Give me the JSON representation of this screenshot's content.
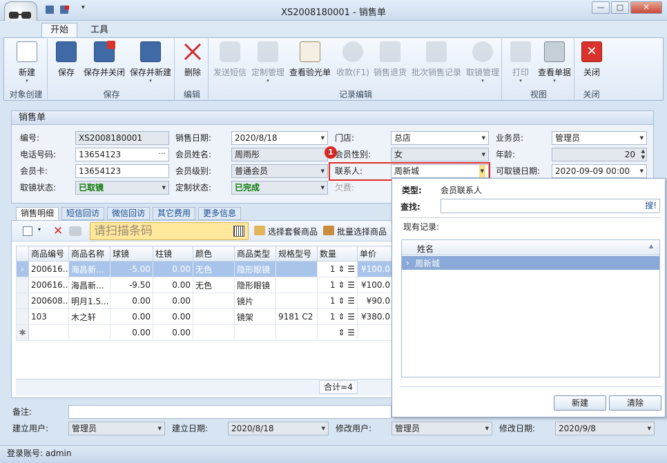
{
  "window": {
    "title": "XS2008180001 - 销售单"
  },
  "ribbon": {
    "tabs": [
      "开始",
      "工具"
    ],
    "groups": [
      "对象创建",
      "保存",
      "编辑",
      "记录编辑",
      "视图",
      "关闭"
    ],
    "buttons": {
      "new": "新建",
      "save": "保存",
      "save_close": "保存并关闭",
      "save_new": "保存并新建",
      "delete": "删除",
      "send_sms": "发送短信",
      "custom_mgmt": "定制管理",
      "view_prescription": "查看验光单",
      "receive": "收款(F1)",
      "sales_return": "销售退货",
      "batch_sales": "批次销售记录",
      "pickup_mgmt": "取镜管理",
      "print": "打印",
      "view_doc": "查看单据",
      "close": "关闭"
    }
  },
  "form": {
    "section_title": "销售单",
    "labels": {
      "order_no": "编号:",
      "sale_date": "销售日期:",
      "store": "门店:",
      "salesman": "业务员:",
      "phone": "电话号码:",
      "member_name": "会员姓名:",
      "member_gender": "会员性别:",
      "age": "年龄:",
      "member_card": "会员卡:",
      "member_level": "会员级别:",
      "contact": "联系人:",
      "pickup_date": "可取镜日期:",
      "pickup_status": "取镜状态:",
      "custom_status": "定制状态:",
      "owed": "欠费:"
    },
    "values": {
      "order_no": "XS2008180001",
      "sale_date": "2020/8/18",
      "store": "总店",
      "salesman": "管理员",
      "phone": "13654123",
      "member_name": "周雨彤",
      "member_gender": "女",
      "age": "20",
      "member_card": "13654123",
      "member_level": "普通会员",
      "contact": "周新城",
      "pickup_date": "2020-09-09 00:00",
      "pickup_status": "已取镜",
      "custom_status": "已完成"
    },
    "callout_badge": "1",
    "phone_dots": "···"
  },
  "detail_tabs": [
    "销售明细",
    "短信回访",
    "微信回访",
    "其它费用",
    "更多信息"
  ],
  "grid_toolbar": {
    "barcode_placeholder": "请扫描条码",
    "select_package": "选择套餐商品",
    "batch_select": "批量选择商品"
  },
  "grid": {
    "columns": [
      "商品编号",
      "商品名称",
      "球镜",
      "柱镜",
      "颜色",
      "商品类型",
      "规格型号",
      "数量",
      "单价"
    ],
    "rows": [
      {
        "code": "200616...",
        "name": "海昌新...",
        "sph": "-5.00",
        "cyl": "0.00",
        "color": "无色",
        "type": "隐形眼镜",
        "spec": "",
        "qty": "1",
        "price": "¥100.0"
      },
      {
        "code": "200616...",
        "name": "海昌新...",
        "sph": "-9.50",
        "cyl": "0.00",
        "color": "无色",
        "type": "隐形眼镜",
        "spec": "",
        "qty": "1",
        "price": "¥100.0"
      },
      {
        "code": "200608...",
        "name": "明月1.5...",
        "sph": "0.00",
        "cyl": "0.00",
        "color": "",
        "type": "镜片",
        "spec": "",
        "qty": "1",
        "price": "¥90.0"
      },
      {
        "code": "103",
        "name": "木之轩",
        "sph": "0.00",
        "cyl": "0.00",
        "color": "",
        "type": "镜架",
        "spec": "9181 C2",
        "qty": "1",
        "price": "¥380.0"
      },
      {
        "code": "",
        "name": "",
        "sph": "0.00",
        "cyl": "0.00",
        "color": "",
        "type": "",
        "spec": "",
        "qty": "",
        "price": ""
      }
    ],
    "summary": "合计=4"
  },
  "popup": {
    "type_label": "类型:",
    "type_value": "会员联系人",
    "search_label": "查找:",
    "search_button": "搜!",
    "records_label": "现有记录:",
    "column": "姓名",
    "rows": [
      "周新城"
    ],
    "new_button": "新建",
    "clear_button": "清除"
  },
  "footer": {
    "remark_label": "备注:",
    "create_user_label": "建立用户:",
    "create_user": "管理员",
    "create_date_label": "建立日期:",
    "create_date": "2020/8/18",
    "modify_user_label": "修改用户:",
    "modify_user": "管理员",
    "modify_date_label": "修改日期:",
    "modify_date": "2020/9/8"
  },
  "status": {
    "login": "登录账号: admin"
  },
  "colors": {
    "accent": "#1a4d8f",
    "highlight": "#e22b2b",
    "selected_row": "#a9c4ea",
    "barcode_bg": "#ffe79b"
  }
}
